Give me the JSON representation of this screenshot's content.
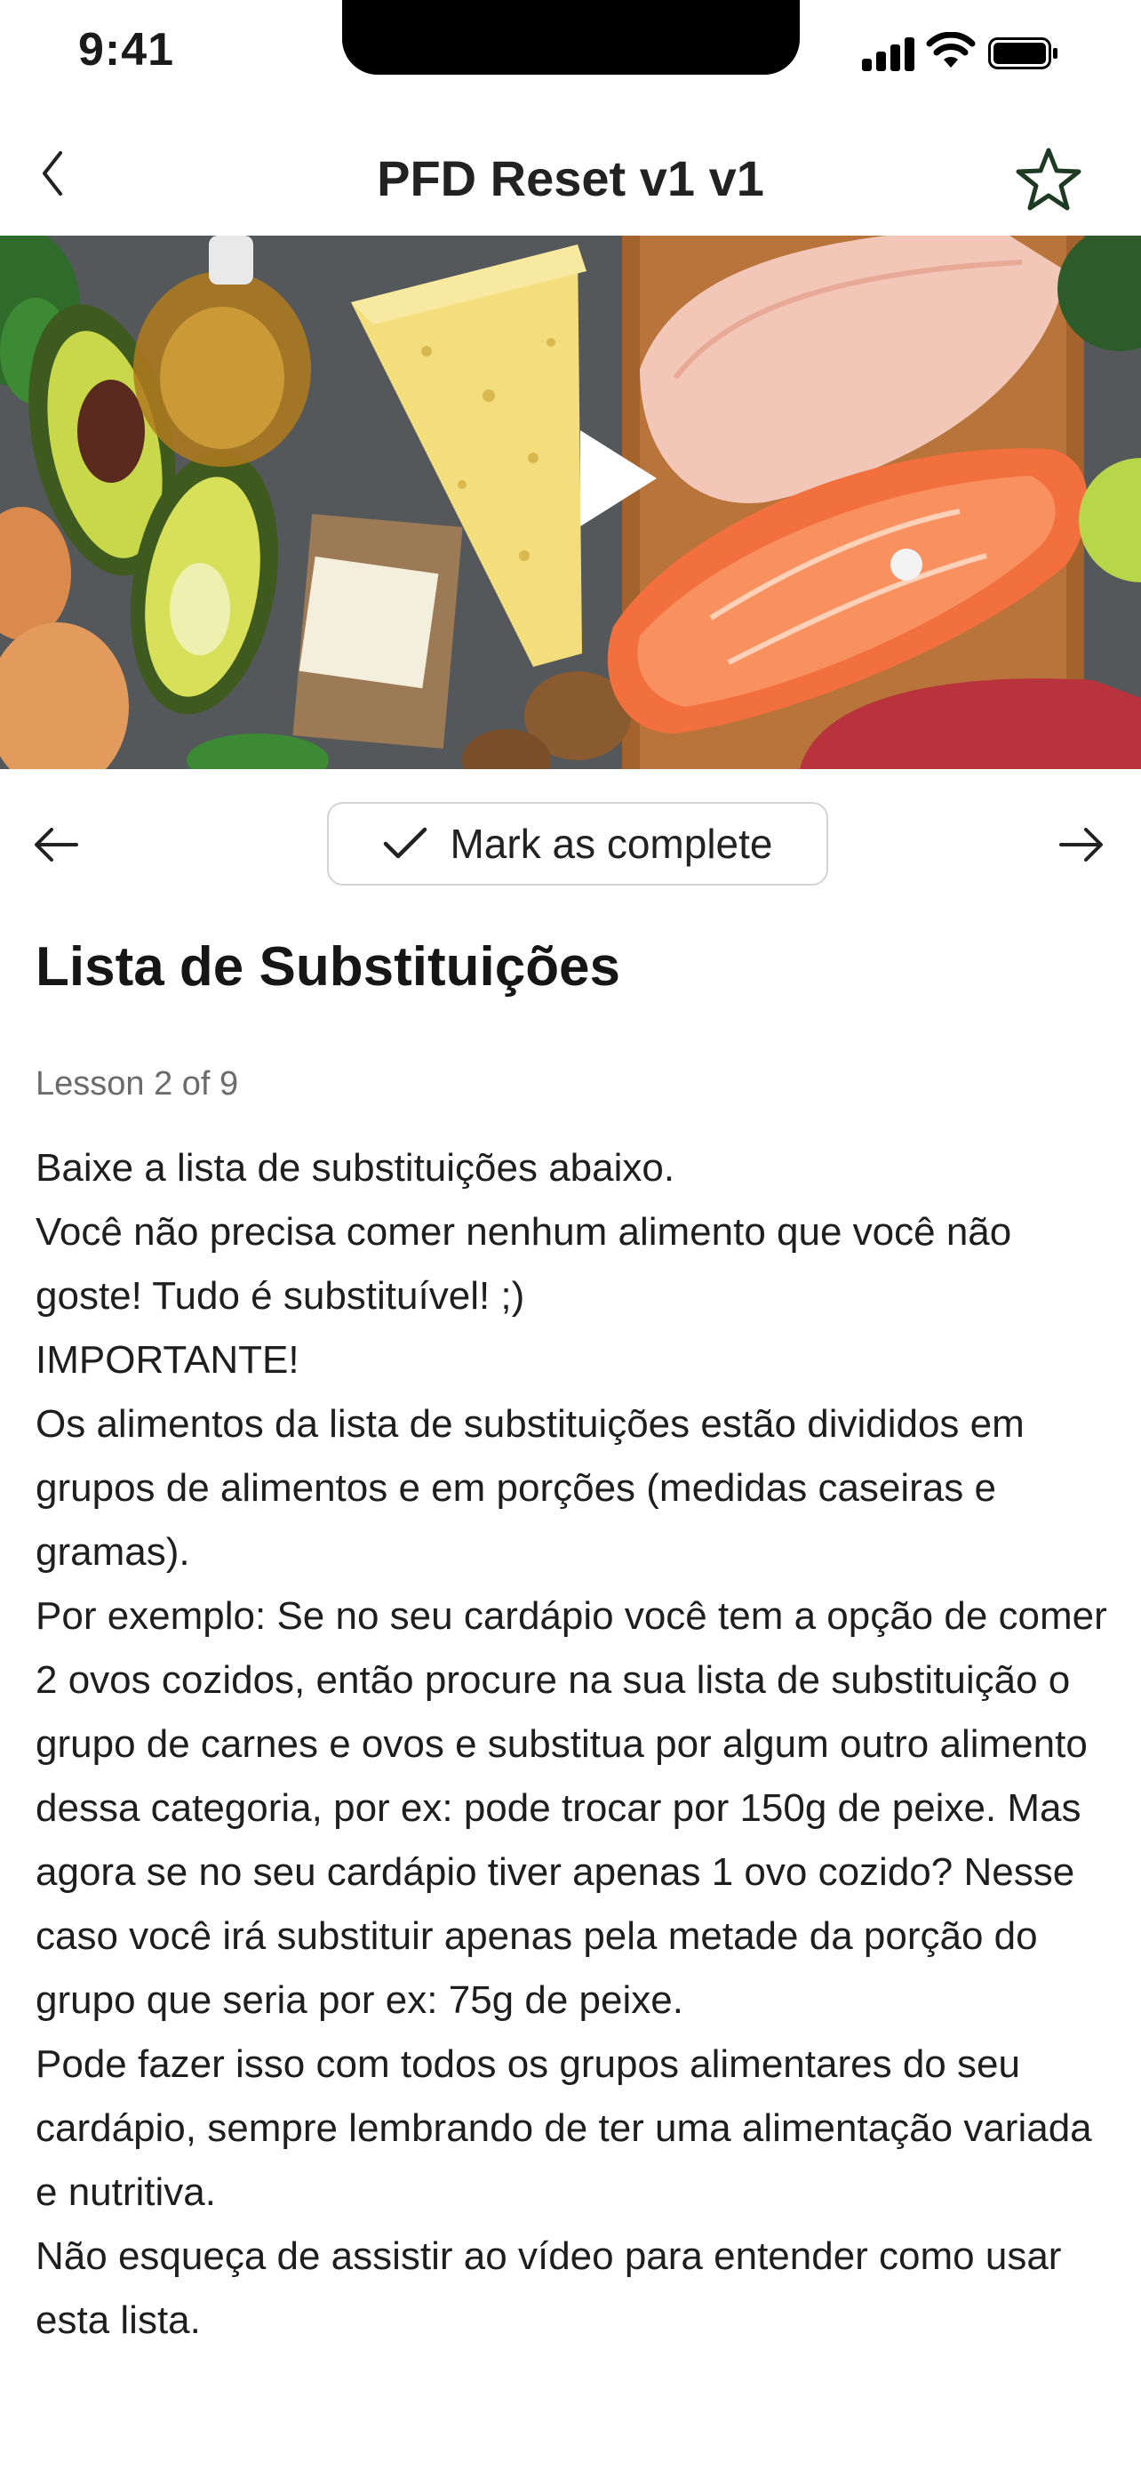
{
  "status_bar": {
    "time": "9:41"
  },
  "nav": {
    "title": "PFD Reset v1 v1",
    "back_icon": "chevron-left-icon",
    "favorite_icon": "star-outline-icon"
  },
  "hero": {
    "play_icon": "play-icon"
  },
  "controls": {
    "prev_icon": "arrow-left-icon",
    "next_icon": "arrow-right-icon",
    "complete_label": "Mark as complete",
    "complete_icon": "checkmark-icon"
  },
  "lesson": {
    "title": "Lista de Substituições",
    "meta": "Lesson 2 of 9",
    "paragraphs": [
      "Baixe a lista de substituições abaixo.",
      "Você não precisa comer nenhum alimento que você não goste! Tudo é substituível! ;)",
      "IMPORTANTE!",
      "Os alimentos da lista de substituições estão divididos em grupos de alimentos e em porções (medidas caseiras e gramas).",
      "Por exemplo: Se no seu cardápio você tem a opção de comer 2 ovos cozidos, então procure na sua lista de substituição o grupo de carnes e ovos e substitua por algum outro alimento dessa categoria, por ex: pode trocar por 150g de peixe. Mas agora se no seu cardápio tiver apenas 1 ovo cozido? Nesse caso você irá substituir apenas pela metade da porção do grupo que seria por ex: 75g de peixe.",
      "Pode fazer isso com todos os grupos alimentares do seu cardápio, sempre lembrando de ter uma alimentação variada e nutritiva.",
      "Não esqueça de assistir ao vídeo para entender como usar esta lista."
    ]
  },
  "colors": {
    "accent_star": "#1f3a23",
    "text": "#1a1a1a",
    "muted": "#6b6b6b",
    "border": "#d4d4d4"
  }
}
